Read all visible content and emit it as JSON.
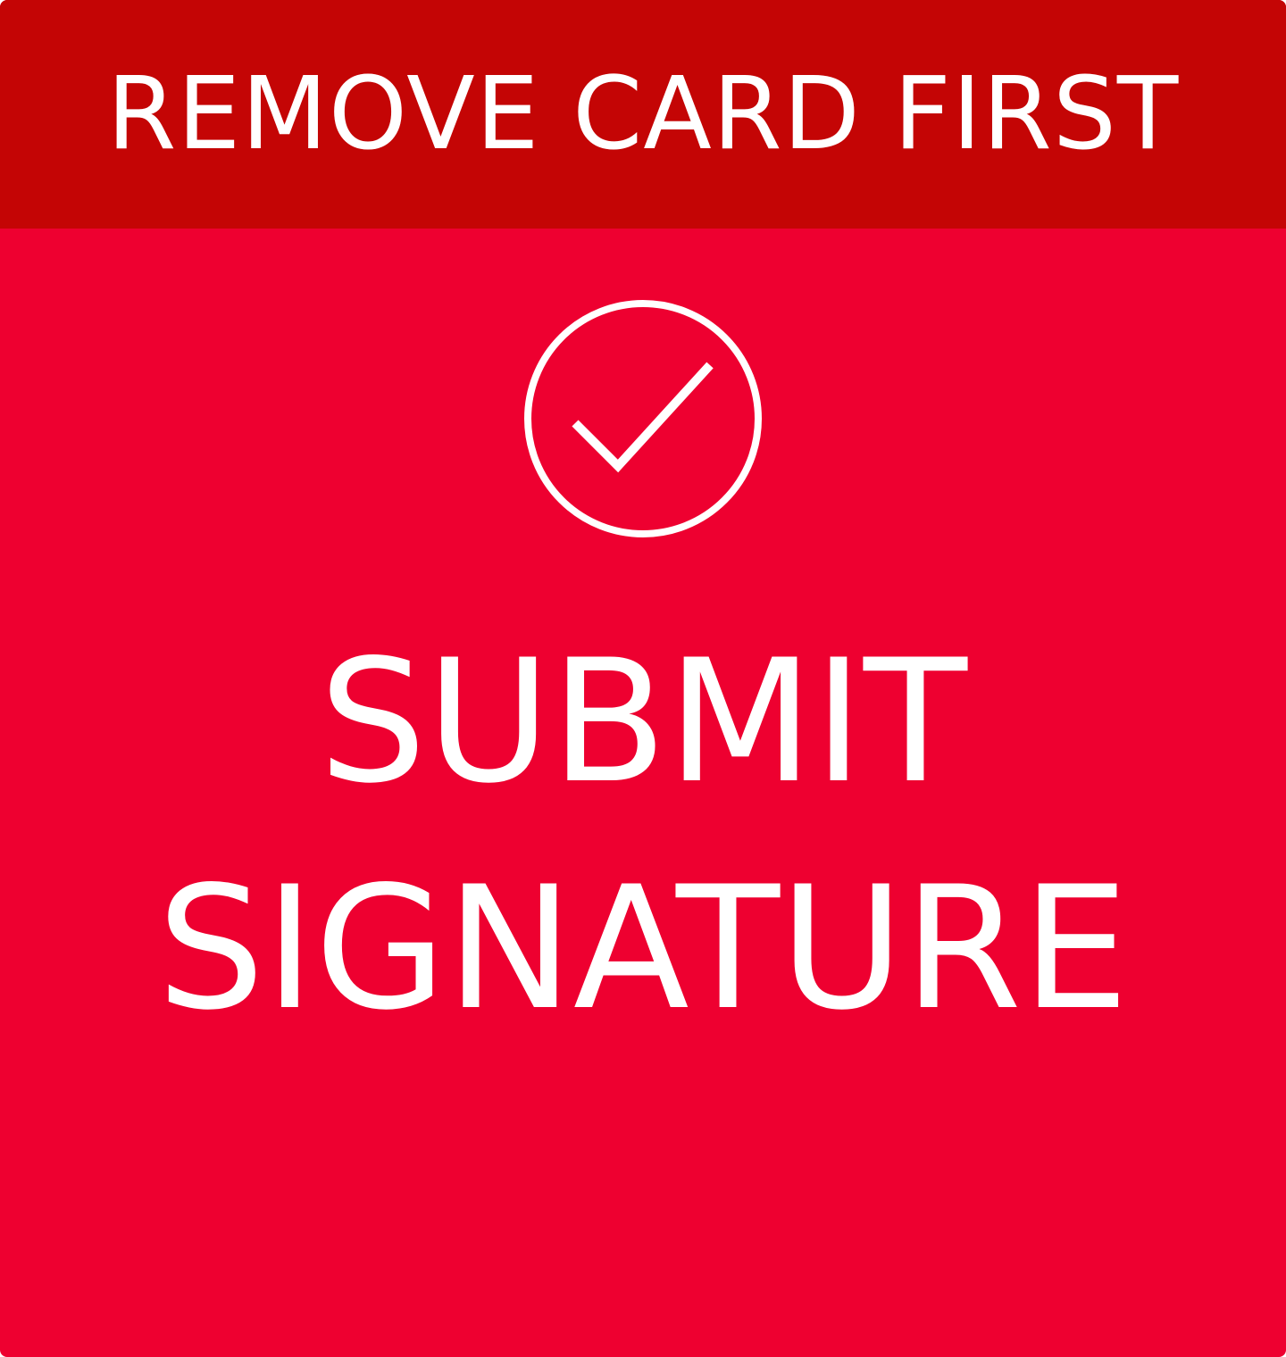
{
  "banner": {
    "text": "REMOVE CARD FIRST"
  },
  "submit": {
    "icon": "check-circle-icon",
    "line1": "SUBMIT",
    "line2": "SIGNATURE"
  },
  "colors": {
    "banner_bg": "#c40505",
    "card_bg": "#ee0030",
    "text": "#ffffff"
  }
}
